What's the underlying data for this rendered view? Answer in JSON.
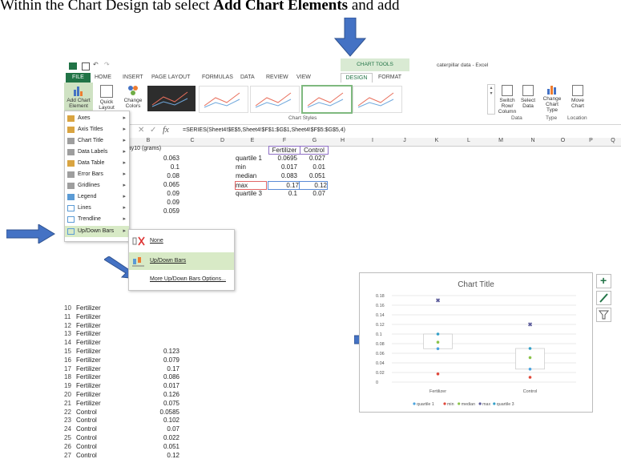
{
  "instruction": {
    "prefix": "Within the Chart Design tab select ",
    "bold": "Add Chart Elements",
    "suffix": " and add"
  },
  "window": {
    "title": "caterpillar data - Excel",
    "chart_tools": "CHART TOOLS"
  },
  "tabs": [
    "FILE",
    "HOME",
    "INSERT",
    "PAGE LAYOUT",
    "FORMULAS",
    "DATA",
    "REVIEW",
    "VIEW",
    "DESIGN",
    "FORMAT"
  ],
  "ribbon": {
    "add_chart": "Add Chart Element",
    "quick_layout": "Quick Layout",
    "change_colors": "Change Colors",
    "chart_styles": "Chart Styles",
    "switch_row": "Switch Row/ Column",
    "select_data": "Select Data",
    "data_group": "Data",
    "change_type": "Change Chart Type",
    "type_group": "Type",
    "move_chart": "Move Chart",
    "location_group": "Location"
  },
  "formula": {
    "fx": "fx",
    "value": "=SERIES(Sheet4!$E$5,Sheet4!$F$1:$G$1,Sheet4!$F$5:$G$5,4)"
  },
  "columns": [
    "B",
    "C",
    "D",
    "E",
    "F",
    "G",
    "H",
    "I",
    "J",
    "K",
    "L",
    "M",
    "N",
    "O",
    "P",
    "Q"
  ],
  "menu": {
    "items": [
      {
        "label": "Axes"
      },
      {
        "label": "Axis Titles"
      },
      {
        "label": "Chart Title"
      },
      {
        "label": "Data Labels"
      },
      {
        "label": "Data Table"
      },
      {
        "label": "Error Bars"
      },
      {
        "label": "Gridlines"
      },
      {
        "label": "Legend"
      },
      {
        "label": "Lines"
      },
      {
        "label": "Trendline"
      },
      {
        "label": "Up/Down Bars"
      }
    ],
    "sub_none": "None",
    "sub_updown": "Up/Down Bars",
    "sub_more": "More Up/Down Bars Options..."
  },
  "sheet": {
    "b_header": "day10 (grams)",
    "b_values": [
      "0.063",
      "0.1",
      "0.08",
      "0.065",
      "0.09",
      "0.09",
      "0.059"
    ],
    "stats_header": [
      "Fertilizer",
      "Control"
    ],
    "stats": [
      {
        "label": "quartile 1",
        "f": "0.0695",
        "g": "0.027"
      },
      {
        "label": "min",
        "f": "0.017",
        "g": "0.01"
      },
      {
        "label": "median",
        "f": "0.083",
        "g": "0.051"
      },
      {
        "label": "max",
        "f": "0.17",
        "g": "0.12"
      },
      {
        "label": "quartile 3",
        "f": "0.1",
        "g": "0.07"
      }
    ],
    "rows": [
      {
        "n": "10",
        "a": "Fertilizer",
        "b": ""
      },
      {
        "n": "11",
        "a": "Fertilizer",
        "b": ""
      },
      {
        "n": "12",
        "a": "Fertilizer",
        "b": ""
      },
      {
        "n": "13",
        "a": "Fertilizer",
        "b": ""
      },
      {
        "n": "14",
        "a": "Fertilizer",
        "b": ""
      },
      {
        "n": "15",
        "a": "Fertilizer",
        "b": "0.123"
      },
      {
        "n": "16",
        "a": "Fertilizer",
        "b": "0.079"
      },
      {
        "n": "17",
        "a": "Fertilizer",
        "b": "0.17"
      },
      {
        "n": "18",
        "a": "Fertilizer",
        "b": "0.086"
      },
      {
        "n": "19",
        "a": "Fertilizer",
        "b": "0.017"
      },
      {
        "n": "20",
        "a": "Fertilizer",
        "b": "0.126"
      },
      {
        "n": "21",
        "a": "Fertilizer",
        "b": "0.075"
      },
      {
        "n": "22",
        "a": "Control",
        "b": "0.0585"
      },
      {
        "n": "23",
        "a": "Control",
        "b": "0.102"
      },
      {
        "n": "24",
        "a": "Control",
        "b": "0.07"
      },
      {
        "n": "25",
        "a": "Control",
        "b": "0.022"
      },
      {
        "n": "26",
        "a": "Control",
        "b": "0.051"
      },
      {
        "n": "27",
        "a": "Control",
        "b": "0.12"
      }
    ]
  },
  "colors": {
    "accent": "#217346",
    "arrow": "#4472c4",
    "quartile1": "#4aa3df",
    "min": "#e0483a",
    "median": "#8bc34a",
    "max": "#5a5a9a",
    "quartile3": "#33a0c8"
  },
  "chart_data": {
    "type": "scatter",
    "title": "Chart Title",
    "categories": [
      "Fertilizer",
      "Control"
    ],
    "ylim": [
      0,
      0.18
    ],
    "yticks": [
      "0",
      "0.02",
      "0.04",
      "0.06",
      "0.08",
      "0.1",
      "0.12",
      "0.14",
      "0.16",
      "0.18"
    ],
    "series": [
      {
        "name": "quartile 1",
        "values": [
          0.0695,
          0.027
        ]
      },
      {
        "name": "min",
        "values": [
          0.017,
          0.01
        ]
      },
      {
        "name": "median",
        "values": [
          0.083,
          0.051
        ]
      },
      {
        "name": "max",
        "values": [
          0.17,
          0.12
        ]
      },
      {
        "name": "quartile 3",
        "values": [
          0.1,
          0.07
        ]
      }
    ],
    "grid": true,
    "legend": "bottom"
  }
}
